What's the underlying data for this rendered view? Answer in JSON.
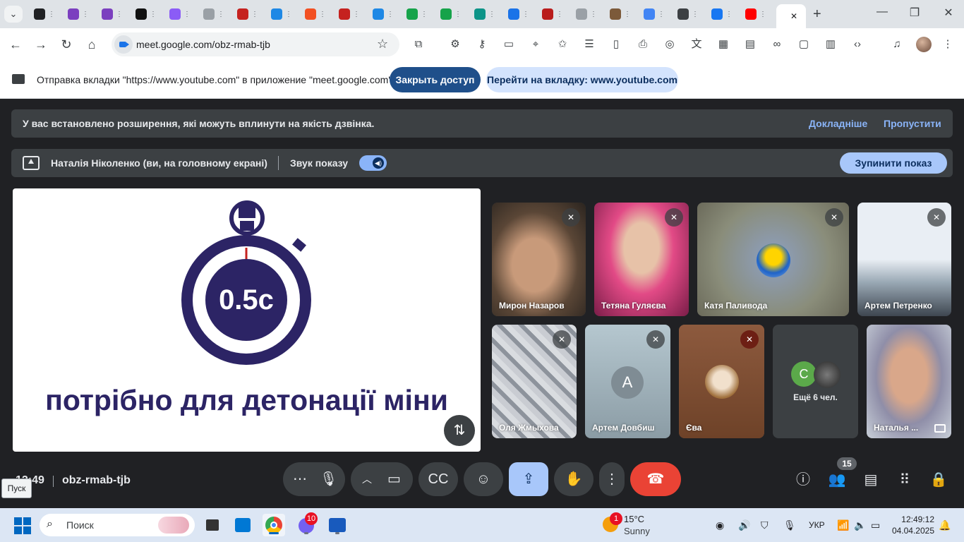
{
  "browser": {
    "tabs": [
      {
        "icon": "tab-favicon",
        "color": "#202124"
      },
      {
        "icon": "tab-favicon",
        "color": "#7b3fbf"
      },
      {
        "icon": "tab-favicon",
        "color": "#7b3fbf"
      },
      {
        "icon": "tab-favicon",
        "color": "#111111"
      },
      {
        "icon": "tab-favicon",
        "color": "#8b5cf6"
      },
      {
        "icon": "tab-favicon",
        "color": "#9aa0a6"
      },
      {
        "icon": "tab-favicon",
        "color": "#c5221f"
      },
      {
        "icon": "tab-favicon",
        "color": "#1e88e5"
      },
      {
        "icon": "tab-favicon",
        "color": "#f25022"
      },
      {
        "icon": "tab-favicon",
        "color": "#c5221f"
      },
      {
        "icon": "tab-favicon",
        "color": "#1e88e5"
      },
      {
        "icon": "tab-favicon",
        "color": "#16a34a"
      },
      {
        "icon": "tab-favicon",
        "color": "#16a34a"
      },
      {
        "icon": "tab-favicon",
        "color": "#0d9488"
      },
      {
        "icon": "tab-favicon",
        "color": "#1a73e8"
      },
      {
        "icon": "tab-favicon",
        "color": "#b91c1c"
      },
      {
        "icon": "tab-favicon",
        "color": "#9aa0a6"
      },
      {
        "icon": "tab-favicon",
        "color": "#7c5a3a"
      },
      {
        "icon": "tab-favicon",
        "color": "#4285f4"
      },
      {
        "icon": "tab-favicon",
        "color": "#3c4043"
      },
      {
        "icon": "tab-favicon",
        "color": "#1877f2"
      },
      {
        "icon": "tab-favicon",
        "color": "#ff0000"
      }
    ],
    "url": "meet.google.com/obz-rmab-tjb"
  },
  "share_bar": {
    "text": "Отправка вкладки \"https://www.youtube.com\" в приложение \"meet.google.com\"...",
    "stop_label": "Закрыть доступ",
    "goto_label": "Перейти на вкладку: www.youtube.com"
  },
  "banner": {
    "text": "У вас встановлено розширення, які можуть вплинути на якість дзвінка.",
    "more_label": "Докладніше",
    "skip_label": "Пропустити"
  },
  "presenting": {
    "name": "Наталія Ніколенко (ви, на головному екрані)",
    "sound_label": "Звук показу",
    "sound_on": true,
    "stop_label": "Зупинити показ"
  },
  "slide": {
    "timer_text": "0.5с",
    "caption": "потрібно для детонації міни"
  },
  "participants": [
    {
      "name": "Мирон Назаров",
      "muted": true
    },
    {
      "name": "Тетяна Гуляєва",
      "muted": true
    },
    {
      "name": "Катя Паливода",
      "muted": true
    },
    {
      "name": "Артем Петренко",
      "muted": true
    },
    {
      "name": "Оля Жмыхова",
      "muted": true
    },
    {
      "name": "Артем Довбиш",
      "muted": true,
      "avatar_letter": "A"
    },
    {
      "name": "Єва",
      "muted": true
    },
    {
      "name": "Ещё 6 чел.",
      "avatar_letter": "C"
    },
    {
      "name": "Наталья ..."
    }
  ],
  "controls": {
    "time": "12:49",
    "meeting_code": "obz-rmab-tjb",
    "participant_count": "15",
    "tooltip": "Пуск"
  },
  "taskbar": {
    "search_placeholder": "Поиск",
    "viber_badge": "10",
    "weather_badge": "1",
    "temperature": "15°C",
    "condition": "Sunny",
    "language": "УКР",
    "time": "12:49:12",
    "date": "04.04.2025"
  }
}
